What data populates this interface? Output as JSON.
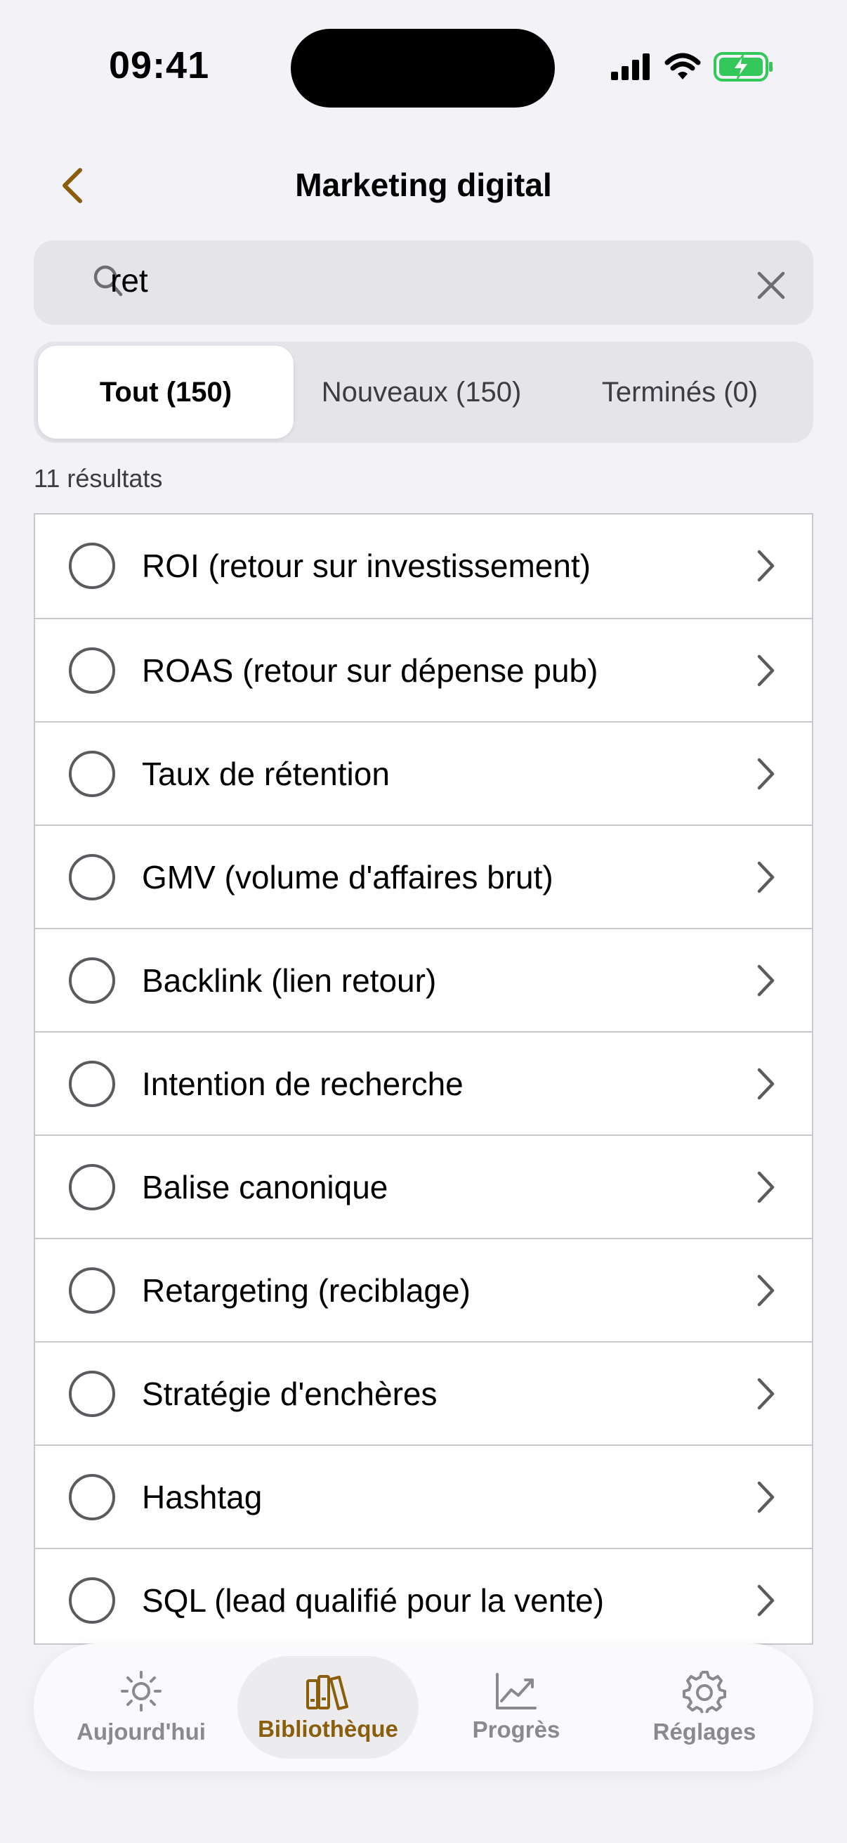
{
  "status_bar": {
    "time": "09:41"
  },
  "nav": {
    "title": "Marketing digital",
    "back_icon": "chevron-left-icon",
    "accent": "#8b5e0c"
  },
  "search": {
    "value": "ret",
    "icon": "search-icon",
    "clear_icon": "close-icon"
  },
  "segments": [
    {
      "label": "Tout (150)",
      "active": true
    },
    {
      "label": "Nouveaux (150)",
      "active": false
    },
    {
      "label": "Terminés (0)",
      "active": false
    }
  ],
  "results": {
    "count_label": "11 résultats"
  },
  "items": [
    {
      "label": "ROI (retour sur investissement)"
    },
    {
      "label": "ROAS (retour sur dépense pub)"
    },
    {
      "label": "Taux de rétention"
    },
    {
      "label": "GMV (volume d'affaires brut)"
    },
    {
      "label": "Backlink (lien retour)"
    },
    {
      "label": "Intention de recherche"
    },
    {
      "label": "Balise canonique"
    },
    {
      "label": "Retargeting (reciblage)"
    },
    {
      "label": "Stratégie d'enchères"
    },
    {
      "label": "Hashtag"
    },
    {
      "label": "SQL (lead qualifié pour la vente)"
    }
  ],
  "tabbar": [
    {
      "label": "Aujourd'hui",
      "icon": "sun-icon",
      "active": false
    },
    {
      "label": "Bibliothèque",
      "icon": "books-icon",
      "active": true
    },
    {
      "label": "Progrès",
      "icon": "chart-icon",
      "active": false
    },
    {
      "label": "Réglages",
      "icon": "gear-icon",
      "active": false
    }
  ]
}
